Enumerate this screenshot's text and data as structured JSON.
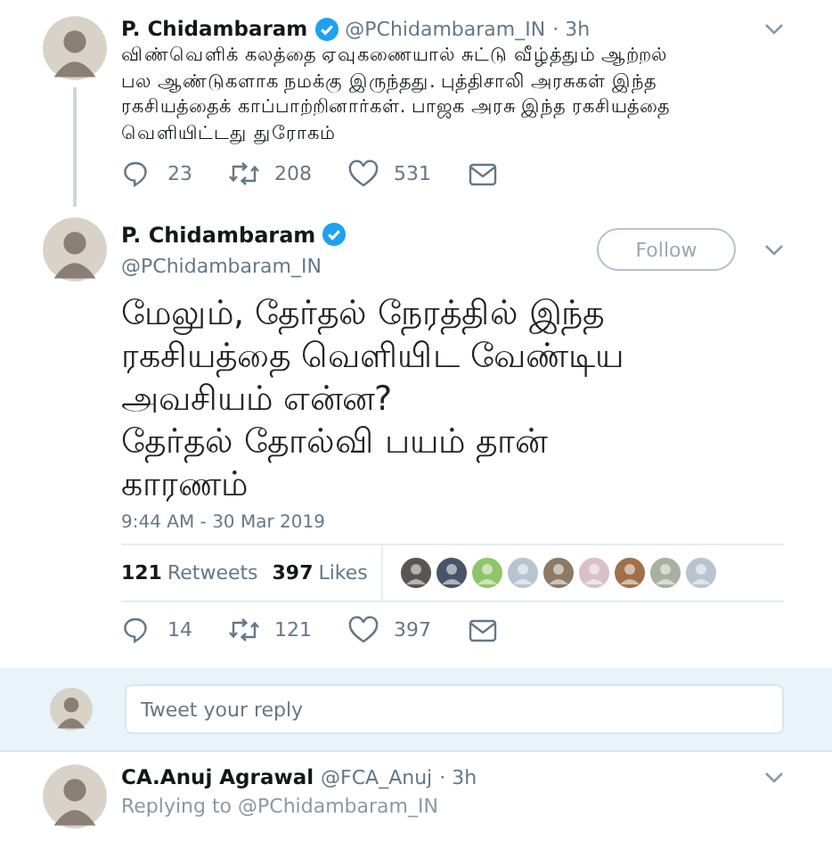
{
  "thread_tweet": {
    "name": "P. Chidambaram",
    "verified": true,
    "handle": "@PChidambaram_IN",
    "time": "· 3h",
    "text": "விண்வெளிக் கலத்தை ஏவுகணையால் சுட்டு வீழ்த்தும் ஆற்றல் பல ஆண்டுகளாக நமக்கு இருந்தது. புத்திசாலி அரசுகள் இந்த ரகசியத்தைக் காப்பாற்றினார்கள். பாஜக அரசு இந்த ரகசியத்தை வெளியிட்டது துரோகம்",
    "actions": [
      {
        "kind": "reply",
        "count": "23"
      },
      {
        "kind": "retweet",
        "count": "208"
      },
      {
        "kind": "like",
        "count": "531"
      },
      {
        "kind": "message"
      }
    ]
  },
  "main_tweet": {
    "name": "P. Chidambaram",
    "verified": true,
    "handle": "@PChidambaram_IN",
    "follow_label": "Follow",
    "text": "மேலும், தேர்தல் நேரத்தில் இந்த ரகசியத்தை வெளியிட வேண்டிய அவசியம் என்ன?\nதேர்தல் தோல்வி பயம் தான் காரணம்",
    "timestamp": "9:44 AM - 30 Mar 2019",
    "stats": [
      {
        "count": "121",
        "label": "Retweets"
      },
      {
        "count": "397",
        "label": "Likes"
      }
    ],
    "likers": [
      {
        "color": "#5a5550"
      },
      {
        "color": "#4a5468"
      },
      {
        "color": "#8fc46a"
      },
      {
        "color": "#b8c4d0"
      },
      {
        "color": "#8a7a66"
      },
      {
        "color": "#d8c0c8"
      },
      {
        "color": "#a0704a"
      },
      {
        "color": "#a8b0a0"
      },
      {
        "color": "#b8c4d0"
      }
    ],
    "actions": [
      {
        "kind": "reply",
        "count": "14"
      },
      {
        "kind": "retweet",
        "count": "121"
      },
      {
        "kind": "like",
        "count": "397"
      },
      {
        "kind": "message"
      }
    ]
  },
  "reply_box": {
    "placeholder": "Tweet your reply"
  },
  "reply_tweet": {
    "name": "CA.Anuj Agrawal",
    "handle": "@FCA_Anuj",
    "time": "· 3h",
    "replying_to": "Replying to @PChidambaram_IN"
  }
}
